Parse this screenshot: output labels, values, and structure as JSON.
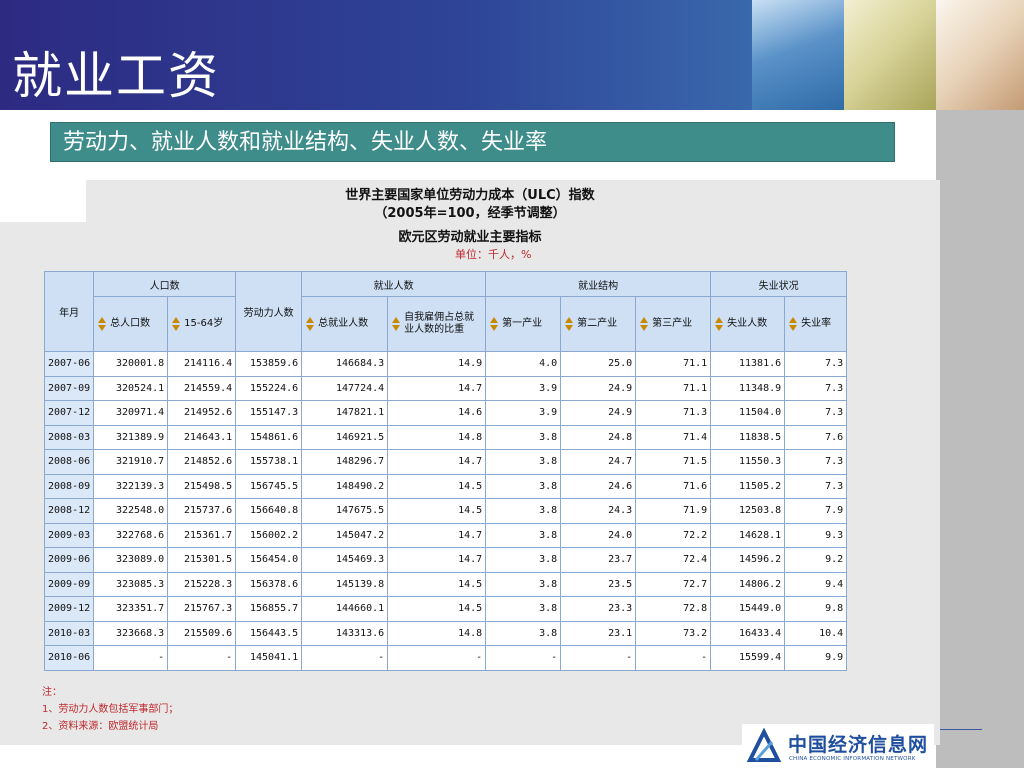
{
  "slide": {
    "title": "就业工资",
    "subtitle": "劳动力、就业人数和就业结构、失业人数、失业率"
  },
  "figure": {
    "title1": "世界主要国家单位劳动力成本（ULC）指数",
    "title2": "（2005年=100，经季节调整）",
    "title3": "欧元区劳动就业主要指标",
    "unit": "单位：千人，%",
    "table": {
      "group_headers": {
        "year": "年月",
        "population": "人口数",
        "labor_force": "劳动力人数",
        "employment": "就业人数",
        "structure": "就业结构",
        "unemployment": "失业状况"
      },
      "columns": [
        "总人口数",
        "15-64岁",
        "总就业人数",
        "自我雇佣占总就业人数的比重",
        "第一产业",
        "第二产业",
        "第三产业",
        "失业人数",
        "失业率"
      ],
      "rows": [
        [
          "2007-06",
          "320001.8",
          "214116.4",
          "153859.6",
          "146684.3",
          "14.9",
          "4.0",
          "25.0",
          "71.1",
          "11381.6",
          "7.3"
        ],
        [
          "2007-09",
          "320524.1",
          "214559.4",
          "155224.6",
          "147724.4",
          "14.7",
          "3.9",
          "24.9",
          "71.1",
          "11348.9",
          "7.3"
        ],
        [
          "2007-12",
          "320971.4",
          "214952.6",
          "155147.3",
          "147821.1",
          "14.6",
          "3.9",
          "24.9",
          "71.3",
          "11504.0",
          "7.3"
        ],
        [
          "2008-03",
          "321389.9",
          "214643.1",
          "154861.6",
          "146921.5",
          "14.8",
          "3.8",
          "24.8",
          "71.4",
          "11838.5",
          "7.6"
        ],
        [
          "2008-06",
          "321910.7",
          "214852.6",
          "155738.1",
          "148296.7",
          "14.7",
          "3.8",
          "24.7",
          "71.5",
          "11550.3",
          "7.3"
        ],
        [
          "2008-09",
          "322139.3",
          "215498.5",
          "156745.5",
          "148490.2",
          "14.5",
          "3.8",
          "24.6",
          "71.6",
          "11505.2",
          "7.3"
        ],
        [
          "2008-12",
          "322548.0",
          "215737.6",
          "156640.8",
          "147675.5",
          "14.5",
          "3.8",
          "24.3",
          "71.9",
          "12503.8",
          "7.9"
        ],
        [
          "2009-03",
          "322768.6",
          "215361.7",
          "156002.2",
          "145047.2",
          "14.7",
          "3.8",
          "24.0",
          "72.2",
          "14628.1",
          "9.3"
        ],
        [
          "2009-06",
          "323089.0",
          "215301.5",
          "156454.0",
          "145469.3",
          "14.7",
          "3.8",
          "23.7",
          "72.4",
          "14596.2",
          "9.2"
        ],
        [
          "2009-09",
          "323085.3",
          "215228.3",
          "156378.6",
          "145139.8",
          "14.5",
          "3.8",
          "23.5",
          "72.7",
          "14806.2",
          "9.4"
        ],
        [
          "2009-12",
          "323351.7",
          "215767.3",
          "156855.7",
          "144660.1",
          "14.5",
          "3.8",
          "23.3",
          "72.8",
          "15449.0",
          "9.8"
        ],
        [
          "2010-03",
          "323668.3",
          "215509.6",
          "156443.5",
          "143313.6",
          "14.8",
          "3.8",
          "23.1",
          "73.2",
          "16433.4",
          "10.4"
        ],
        [
          "2010-06",
          "-",
          "-",
          "145041.1",
          "-",
          "-",
          "-",
          "-",
          "-",
          "15599.4",
          "9.9"
        ]
      ]
    },
    "notes": [
      "注：",
      "1、劳动力人数包括军事部门；",
      "2、资料来源：欧盟统计局"
    ]
  },
  "logo": {
    "cn": "中国经济信息网",
    "en": "CHINA ECONOMIC INFORMATION NETWORK"
  },
  "colors": {
    "banner": "#2e4497",
    "subtitle_bar": "#3f8d8a",
    "header_cell": "#cfe0f5",
    "note_red": "#c0282d"
  }
}
